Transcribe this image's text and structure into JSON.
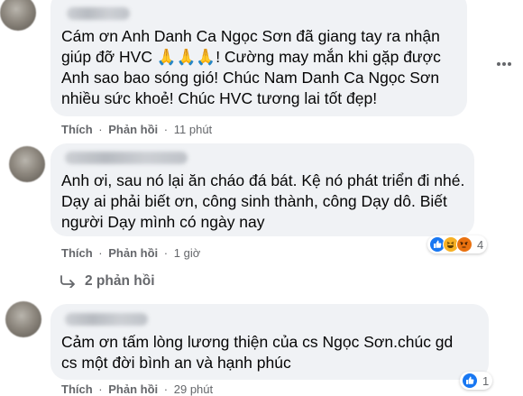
{
  "comments": [
    {
      "text_lines": [
        "Cám ơn Anh Danh Ca Ngọc Sơn đã giang tay ra nhận",
        "giúp đỡ HVC 🙏🙏🙏! Cường may mắn khi gặp được",
        "Anh sao bao sóng gió! Chúc Nam Danh Ca Ngọc Sơn",
        "nhiều sức khoẻ! Chúc HVC tương lai tốt đẹp!"
      ],
      "like_label": "Thích",
      "reply_label": "Phản hồi",
      "time": "11 phút"
    },
    {
      "text_lines": [
        "Anh ơi, sau nó lại ăn cháo đá bát. Kệ nó phát triển đi nhé.",
        "Dạy ai phải biết ơn, công sinh thành, công Dạy dô. Biết",
        "người Dạy mình có ngày nay"
      ],
      "like_label": "Thích",
      "reply_label": "Phản hồi",
      "time": "1 giờ",
      "reactions": [
        "like",
        "haha",
        "angry"
      ],
      "reaction_count": "4",
      "replies_label": "2 phản hồi"
    },
    {
      "text_lines": [
        "Cảm ơn tấm lòng lương thiện của cs Ngọc Sơn.chúc gd",
        "cs một đời bình an và hạnh phúc"
      ],
      "like_label": "Thích",
      "reply_label": "Phản hồi",
      "time": "29 phút",
      "reactions": [
        "like"
      ],
      "reaction_count": "1"
    }
  ],
  "separator": "·",
  "colors": {
    "bubble": "#f0f2f5",
    "secondary_text": "#65676b",
    "like_blue": "#1877f2",
    "haha_yellow": "#f7b125",
    "angry_orange": "#e9710f"
  }
}
